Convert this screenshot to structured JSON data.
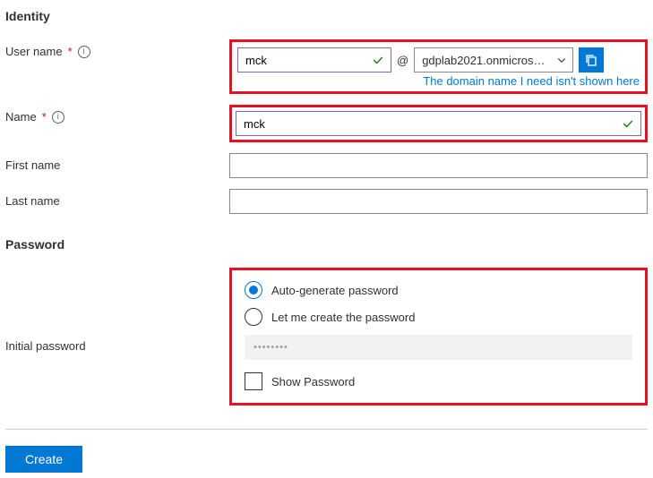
{
  "identity": {
    "heading": "Identity",
    "username_label": "User name",
    "username_value": "mck",
    "at": "@",
    "domain_value": "gdplab2021.onmicrosoft....",
    "helper_link": "The domain name I need isn't shown here",
    "name_label": "Name",
    "name_value": "mck",
    "firstname_label": "First name",
    "firstname_value": "",
    "lastname_label": "Last name",
    "lastname_value": ""
  },
  "password": {
    "heading": "Password",
    "radio_auto": "Auto-generate password",
    "radio_manual": "Let me create the password",
    "initial_label": "Initial password",
    "masked": "••••••••",
    "show_label": "Show Password"
  },
  "actions": {
    "create": "Create"
  }
}
